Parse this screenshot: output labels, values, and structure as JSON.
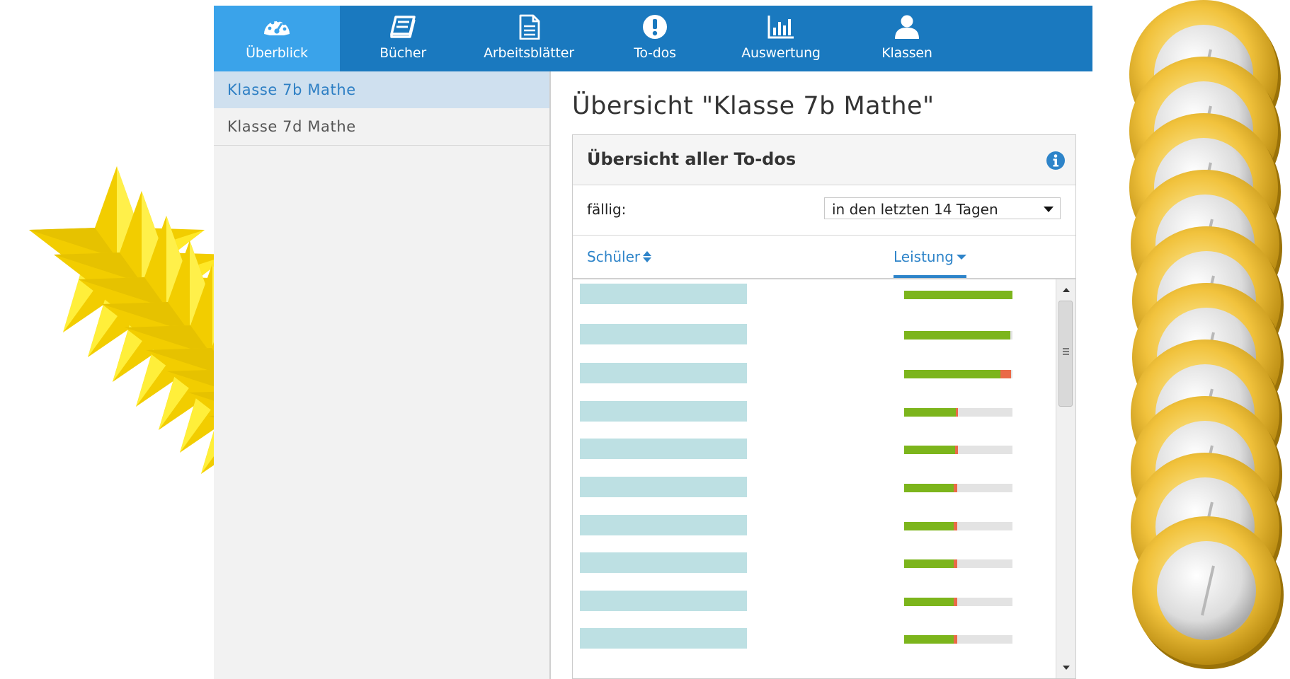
{
  "nav": {
    "items": [
      {
        "label": "Überblick",
        "icon": "dashboard-gauge-icon",
        "active": true
      },
      {
        "label": "Bücher",
        "icon": "book-icon",
        "active": false
      },
      {
        "label": "Arbeitsblätter",
        "icon": "document-icon",
        "active": false
      },
      {
        "label": "To-dos",
        "icon": "exclamation-icon",
        "active": false
      },
      {
        "label": "Auswertung",
        "icon": "bar-chart-icon",
        "active": false
      },
      {
        "label": "Klassen",
        "icon": "user-icon",
        "active": false
      }
    ]
  },
  "sidebar": {
    "items": [
      {
        "label": "Klasse 7b Mathe",
        "active": true
      },
      {
        "label": "Klasse 7d Mathe",
        "active": false
      }
    ]
  },
  "main": {
    "title": "Übersicht \"Klasse 7b Mathe\""
  },
  "panel": {
    "title": "Übersicht aller To-dos",
    "filter_label": "fällig:",
    "filter_value": "in den letzten 14 Tagen",
    "col_student": "Schüler",
    "col_performance": "Leistung",
    "sort_column": "Leistung",
    "sort_direction": "descending"
  },
  "rows": [
    {
      "correct": 1.0,
      "wrong": 0.0
    },
    {
      "correct": 0.98,
      "wrong": 0.0
    },
    {
      "correct": 0.89,
      "wrong": 0.1
    },
    {
      "correct": 0.48,
      "wrong": 0.02
    },
    {
      "correct": 0.47,
      "wrong": 0.03
    },
    {
      "correct": 0.46,
      "wrong": 0.03
    },
    {
      "correct": 0.46,
      "wrong": 0.03
    },
    {
      "correct": 0.46,
      "wrong": 0.03
    },
    {
      "correct": 0.46,
      "wrong": 0.03
    },
    {
      "correct": 0.46,
      "wrong": 0.03
    }
  ],
  "colors": {
    "nav_bg": "#1a79bf",
    "nav_active": "#3aa3ea",
    "accent": "#2e84c9",
    "correct": "#7cb51c",
    "wrong": "#ea6a48",
    "remaining": "#e3e3e3"
  }
}
